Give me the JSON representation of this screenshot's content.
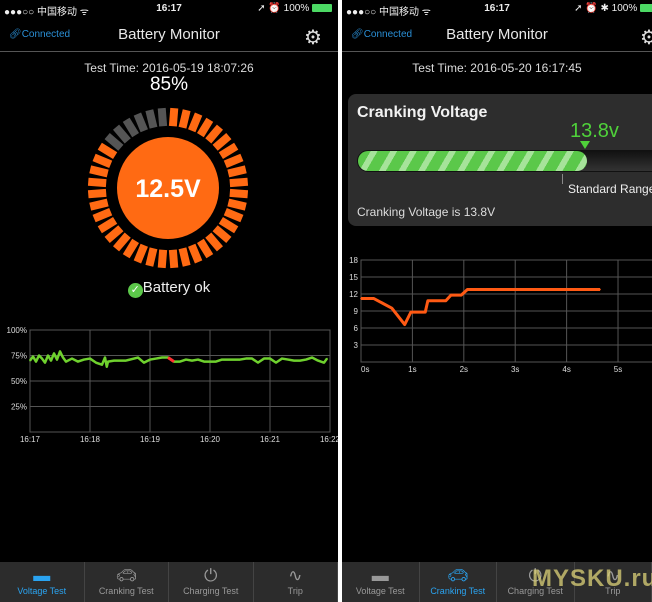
{
  "status": {
    "carrier": "●●●○○ 中国移动 ᯤ",
    "time": "16:17",
    "right_left": "➚ ⏰ 100%",
    "right_right": "➚ ⏰ ✱ 100%"
  },
  "header": {
    "connected": "Connected",
    "title": "Battery Monitor",
    "gear_icon": "gear-icon",
    "link_icon": "link-icon"
  },
  "voltage_screen": {
    "test_time": "Test Time:  2016-05-19 18:07:26",
    "percent": "85%",
    "voltage": "12.5V",
    "gauge_level": 0.85,
    "status": "Battery ok",
    "gauge_color": "#ff6a13",
    "gauge_off_color": "#555555"
  },
  "cranking_screen": {
    "test_time": "Test Time:  2016-05-20 16:17:45",
    "card_title": "Cranking Voltage",
    "value": "13.8v",
    "standard_range": "Standard Range",
    "summary": "Cranking Voltage is 13.8V"
  },
  "tabs": [
    {
      "label": "Voltage Test",
      "icon": "battery-icon"
    },
    {
      "label": "Cranking Test",
      "icon": "car-icon"
    },
    {
      "label": "Charging Test",
      "icon": "plug-icon"
    },
    {
      "label": "Trip",
      "icon": "route-icon"
    }
  ],
  "watermark": "MYSKU.ru",
  "chart_data": [
    {
      "type": "line",
      "yticks": [
        "100%",
        "75%",
        "50%",
        "25%"
      ],
      "xticks": [
        "16:17",
        "16:18",
        "16:19",
        "16:20",
        "16:21",
        "16:22"
      ],
      "ylim": [
        0,
        100
      ],
      "grid": true,
      "color": "#6fd12e",
      "highlight_color": "#ff3030",
      "x": [
        0,
        0.05,
        0.1,
        0.15,
        0.2,
        0.25,
        0.3,
        0.35,
        0.4,
        0.45,
        0.5,
        0.55,
        0.6,
        0.7,
        0.8,
        0.9,
        1.0,
        1.1,
        1.2,
        1.25,
        1.28,
        1.3,
        1.4,
        1.6,
        1.8,
        1.9,
        2.0,
        2.1,
        2.2,
        2.3,
        2.4,
        2.5,
        2.6,
        2.7,
        2.8,
        2.9,
        3.0,
        3.1,
        3.2,
        3.3,
        3.4,
        3.5,
        3.6,
        3.7,
        3.8,
        3.9,
        4.0,
        4.1,
        4.2,
        4.3,
        4.4,
        4.5,
        4.6,
        4.7,
        4.8,
        4.9,
        4.95
      ],
      "values": [
        70,
        74,
        69,
        75,
        72,
        68,
        75,
        70,
        77,
        71,
        79,
        73,
        69,
        72,
        69,
        71,
        72,
        68,
        66,
        73,
        64,
        69,
        70,
        70,
        73,
        68,
        71,
        72,
        73,
        73,
        69,
        69,
        71,
        70,
        71,
        69,
        69,
        69,
        71,
        71,
        71,
        71,
        72,
        72,
        68,
        72,
        72,
        68,
        72,
        71,
        70,
        70,
        71,
        73,
        70,
        68,
        72
      ],
      "highlight_x": [
        2.3,
        2.4
      ]
    },
    {
      "type": "line",
      "yticks": [
        "18",
        "15",
        "12",
        "9",
        "6",
        "3"
      ],
      "xticks": [
        "0s",
        "1s",
        "2s",
        "3s",
        "4s",
        "5s"
      ],
      "ylim": [
        0,
        18
      ],
      "xlim": [
        0,
        5.7
      ],
      "grid": true,
      "color": "#ff5a14",
      "x": [
        0,
        0.25,
        0.6,
        0.85,
        0.97,
        1.25,
        1.3,
        1.65,
        1.75,
        1.95,
        2.07,
        4.65
      ],
      "values": [
        11.2,
        11.2,
        9.5,
        6.6,
        8.8,
        8.8,
        10.8,
        10.8,
        11.8,
        11.8,
        12.8,
        12.8
      ]
    }
  ]
}
